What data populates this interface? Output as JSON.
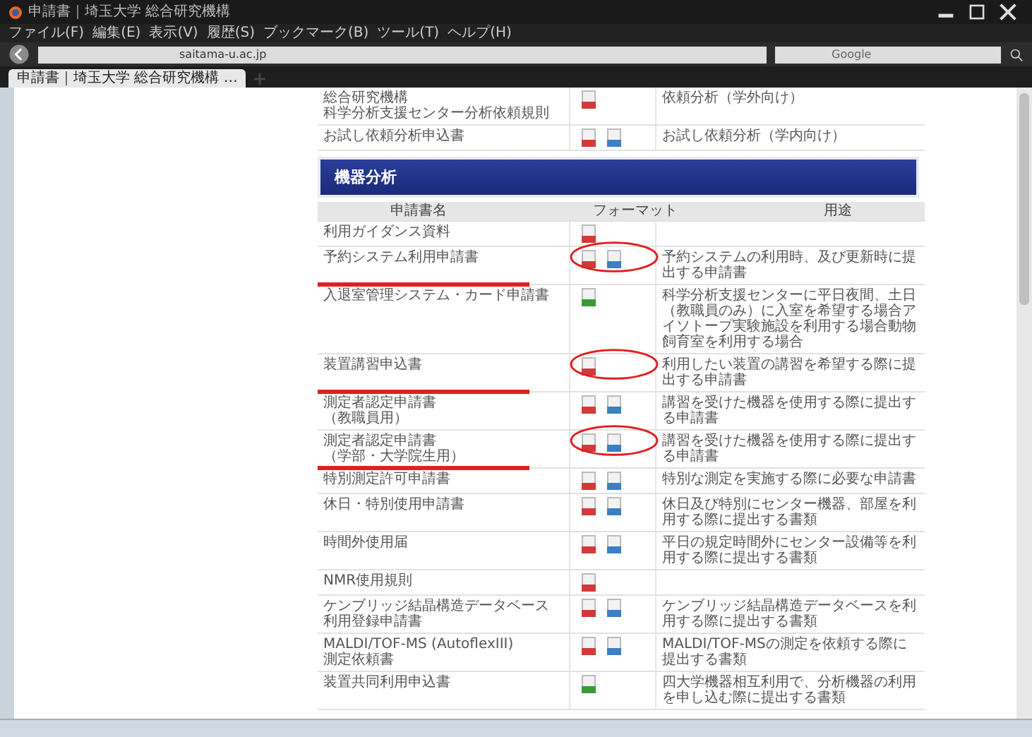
{
  "window": {
    "title": "申請書｜埼玉大学 総合研究機構"
  },
  "menu": [
    "ファイル(F)",
    "編集(E)",
    "表示(V)",
    "履歴(S)",
    "ブックマーク(B)",
    "ツール(T)",
    "ヘルプ(H)"
  ],
  "address": {
    "value": "saitama-u.ac.jp"
  },
  "search": {
    "placeholder": "Google"
  },
  "tabs": [
    {
      "label": "申請書｜埼玉大学 総合研究機構 …",
      "selected": true
    }
  ],
  "top_rows": [
    {
      "name": [
        "総合研究機構",
        "科学分析支援センター分析依頼規則"
      ],
      "files": [
        {
          "kind": "pdf"
        }
      ],
      "purpose": "依頼分析（学外向け）"
    },
    {
      "name": [
        "お試し依頼分析申込書"
      ],
      "files": [
        {
          "kind": "pdf"
        },
        {
          "kind": "doc"
        }
      ],
      "purpose": "お試し依頼分析（学内向け）"
    }
  ],
  "section": {
    "title": "機器分析",
    "columns": [
      "申請書名",
      "フォーマット",
      "用途"
    ],
    "rows": [
      {
        "name": [
          "利用ガイダンス資料"
        ],
        "files": [
          {
            "kind": "pdf"
          }
        ],
        "annotated": false
      },
      {
        "name": [
          "予約システム利用申請書"
        ],
        "files": [
          {
            "kind": "pdf"
          },
          {
            "kind": "doc"
          }
        ],
        "purpose": "予約システムの利用時、及び更新時に提出する申請書",
        "annotated": true
      },
      {
        "name": [
          "入退室管理システム・カード申請書"
        ],
        "files": [
          {
            "kind": "xls"
          }
        ],
        "purpose": "科学分析支援センターに平日夜間、土日（教職員のみ）に入室を希望する場合アイソトープ実験施設を利用する場合動物飼育室を利用する場合",
        "annotated": false
      },
      {
        "name": [
          "装置講習申込書"
        ],
        "files": [
          {
            "kind": "pdf"
          }
        ],
        "purpose": "利用したい装置の講習を希望する際に提出する申請書",
        "annotated": true
      },
      {
        "name": [
          "測定者認定申請書",
          "（教職員用）"
        ],
        "files": [
          {
            "kind": "pdf"
          },
          {
            "kind": "doc"
          }
        ],
        "purpose": "講習を受けた機器を使用する際に提出する申請書",
        "annotated": false
      },
      {
        "name": [
          "測定者認定申請書",
          "（学部・大学院生用）"
        ],
        "files": [
          {
            "kind": "pdf"
          },
          {
            "kind": "doc"
          }
        ],
        "purpose": "講習を受けた機器を使用する際に提出する申請書",
        "annotated": true
      },
      {
        "name": [
          "特別測定許可申請書"
        ],
        "files": [
          {
            "kind": "pdf"
          },
          {
            "kind": "doc"
          }
        ],
        "purpose": "特別な測定を実施する際に必要な申請書",
        "annotated": false
      },
      {
        "name": [
          "休日・特別使用申請書"
        ],
        "files": [
          {
            "kind": "pdf"
          },
          {
            "kind": "doc"
          }
        ],
        "purpose": "休日及び特別にセンター機器、部屋を利用する際に提出する書類",
        "annotated": false
      },
      {
        "name": [
          "時間外使用届"
        ],
        "files": [
          {
            "kind": "pdf"
          },
          {
            "kind": "doc"
          }
        ],
        "purpose": "平日の規定時間外にセンター設備等を利用する際に提出する書類",
        "annotated": false
      },
      {
        "name": [
          "NMR使用規則"
        ],
        "files": [
          {
            "kind": "pdf"
          }
        ],
        "annotated": false
      },
      {
        "name": [
          "ケンブリッジ結晶構造データベース",
          "利用登録申請書"
        ],
        "files": [
          {
            "kind": "pdf"
          },
          {
            "kind": "doc"
          }
        ],
        "purpose": "ケンブリッジ結晶構造データベースを利用する際に提出する書類",
        "annotated": false
      },
      {
        "name": [
          "MALDI/TOF-MS (AutoflexIII)",
          "測定依頼書"
        ],
        "files": [
          {
            "kind": "pdf"
          },
          {
            "kind": "doc"
          }
        ],
        "purpose": "MALDI/TOF-MSの測定を依頼する際に提出する書類",
        "annotated": false
      },
      {
        "name": [
          "装置共同利用申込書"
        ],
        "files": [
          {
            "kind": "xls"
          }
        ],
        "purpose": "四大学機器相互利用で、分析機器の利用を申し込む際に提出する書類",
        "annotated": false
      }
    ]
  }
}
